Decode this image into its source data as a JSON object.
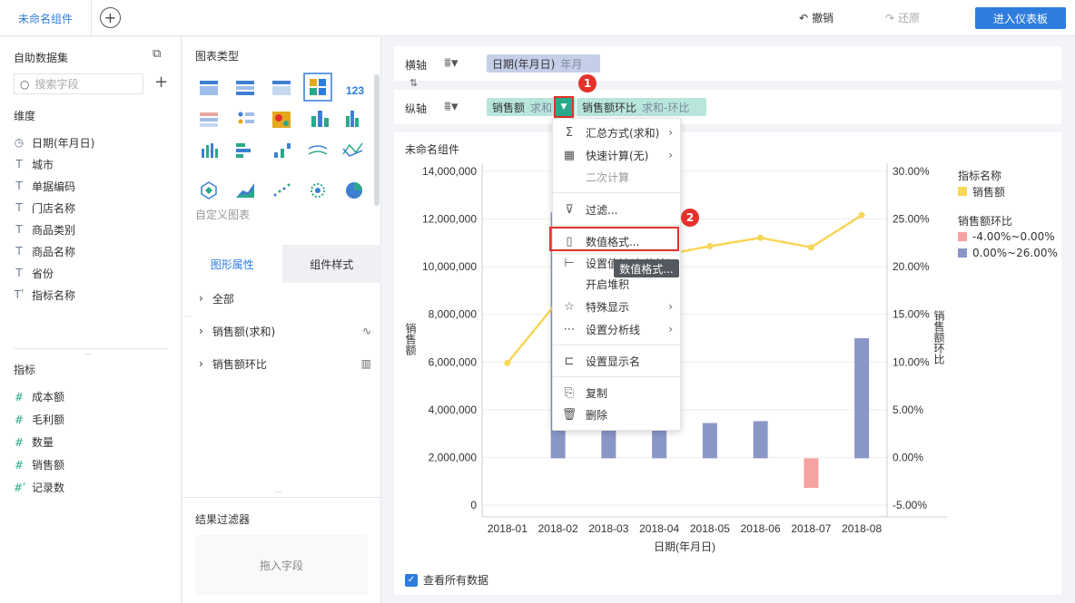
{
  "header": {
    "tab_label": "未命名组件",
    "add_tab": "+",
    "undo_label": "撤销",
    "redo_label": "还原",
    "enter_dashboard": "进入仪表板"
  },
  "left": {
    "dataset_title": "自助数据集",
    "search_placeholder": "搜索字段",
    "dimension_title": "维度",
    "dimensions": [
      {
        "icon": "clock",
        "label": "日期(年月日)"
      },
      {
        "icon": "T",
        "label": "城市"
      },
      {
        "icon": "T",
        "label": "单据编码"
      },
      {
        "icon": "T",
        "label": "门店名称"
      },
      {
        "icon": "T",
        "label": "商品类别"
      },
      {
        "icon": "T",
        "label": "商品名称"
      },
      {
        "icon": "T",
        "label": "省份"
      },
      {
        "icon": "T'",
        "label": "指标名称"
      }
    ],
    "measure_title": "指标",
    "measures": [
      {
        "icon": "#",
        "label": "成本额"
      },
      {
        "icon": "#",
        "label": "毛利额"
      },
      {
        "icon": "#",
        "label": "数量"
      },
      {
        "icon": "#",
        "label": "销售额"
      },
      {
        "icon": "#'",
        "label": "记录数"
      }
    ]
  },
  "middle": {
    "chart_type_title": "图表类型",
    "custom_chart": "自定义图表",
    "tab_graphic": "图形属性",
    "tab_style": "组件样式",
    "props": [
      {
        "label": "全部"
      },
      {
        "label": "销售额(求和)"
      },
      {
        "label": "销售额环比"
      }
    ],
    "filter_title": "结果过滤器",
    "drop_hint": "拖入字段"
  },
  "axes": {
    "x_label": "横轴",
    "y_label": "纵轴",
    "x_field": "日期(年月日)",
    "x_field_sub": "年月",
    "y_field1": "销售额",
    "y_field1_sub": "求和",
    "y_field2": "销售额环比",
    "y_field2_sub": "求和-环比"
  },
  "chart_title": "未命名组件",
  "menu": {
    "items": [
      {
        "icon": "Σ",
        "label": "汇总方式(求和)",
        "arrow": true
      },
      {
        "icon": "calc",
        "label": "快速计算(无)",
        "arrow": true
      },
      {
        "icon": "",
        "label": "二次计算",
        "disabled": true
      },
      {
        "icon": "filter",
        "label": "过滤..."
      },
      {
        "icon": "format",
        "label": "数值格式..."
      },
      {
        "icon": "ruler",
        "label": "设置值轴(左值轴)"
      },
      {
        "icon": "",
        "label": "开启堆积"
      },
      {
        "icon": "star",
        "label": "特殊显示",
        "arrow": true
      },
      {
        "icon": "line",
        "label": "设置分析线",
        "arrow": true
      },
      {
        "icon": "tag",
        "label": "设置显示名"
      },
      {
        "icon": "copy",
        "label": "复制"
      },
      {
        "icon": "trash",
        "label": "删除"
      }
    ],
    "tooltip": "数值格式...",
    "badge1": "1",
    "badge2": "2"
  },
  "legend": {
    "title1": "指标名称",
    "item1": "销售额",
    "title2": "销售额环比",
    "item2": "-4.00%~0.00%",
    "item3": "0.00%~26.00%"
  },
  "footer": {
    "show_all": "查看所有数据"
  },
  "colors": {
    "accent": "#2e7dde",
    "bar_positive": "#8a96c6",
    "bar_negative": "#f4a3a0",
    "line": "#f7d658",
    "badge": "#e5312b"
  },
  "chart_data": {
    "type": "bar",
    "categories": [
      "2018-01",
      "2018-02",
      "2018-03",
      "2018-04",
      "2018-05",
      "2018-06",
      "2018-07",
      "2018-08"
    ],
    "xlabel": "日期(年月日)",
    "ylabel": "销售额",
    "y2label": "销售额环比",
    "ylim": [
      0,
      14000000
    ],
    "y2lim": [
      -5,
      30
    ],
    "yticks": [
      "14,000,000",
      "12,000,000",
      "10,000,000",
      "8,000,000",
      "6,000,000",
      "4,000,000",
      "2,000,000",
      "0"
    ],
    "y2ticks": [
      "30.00%",
      "25.00%",
      "20.00%",
      "15.00%",
      "10.00%",
      "5.00%",
      "0.00%",
      "-5.00%"
    ],
    "series": [
      {
        "name": "销售额",
        "type": "line",
        "values": [
          6000000,
          8600000,
          9800000,
          10500000,
          10900000,
          11250000,
          10850000,
          12200000
        ]
      },
      {
        "name": "销售额环比",
        "type": "bar",
        "values": [
          null,
          25.8,
          12.0,
          3.8,
          3.7,
          3.9,
          -3.1,
          12.6
        ]
      }
    ]
  }
}
